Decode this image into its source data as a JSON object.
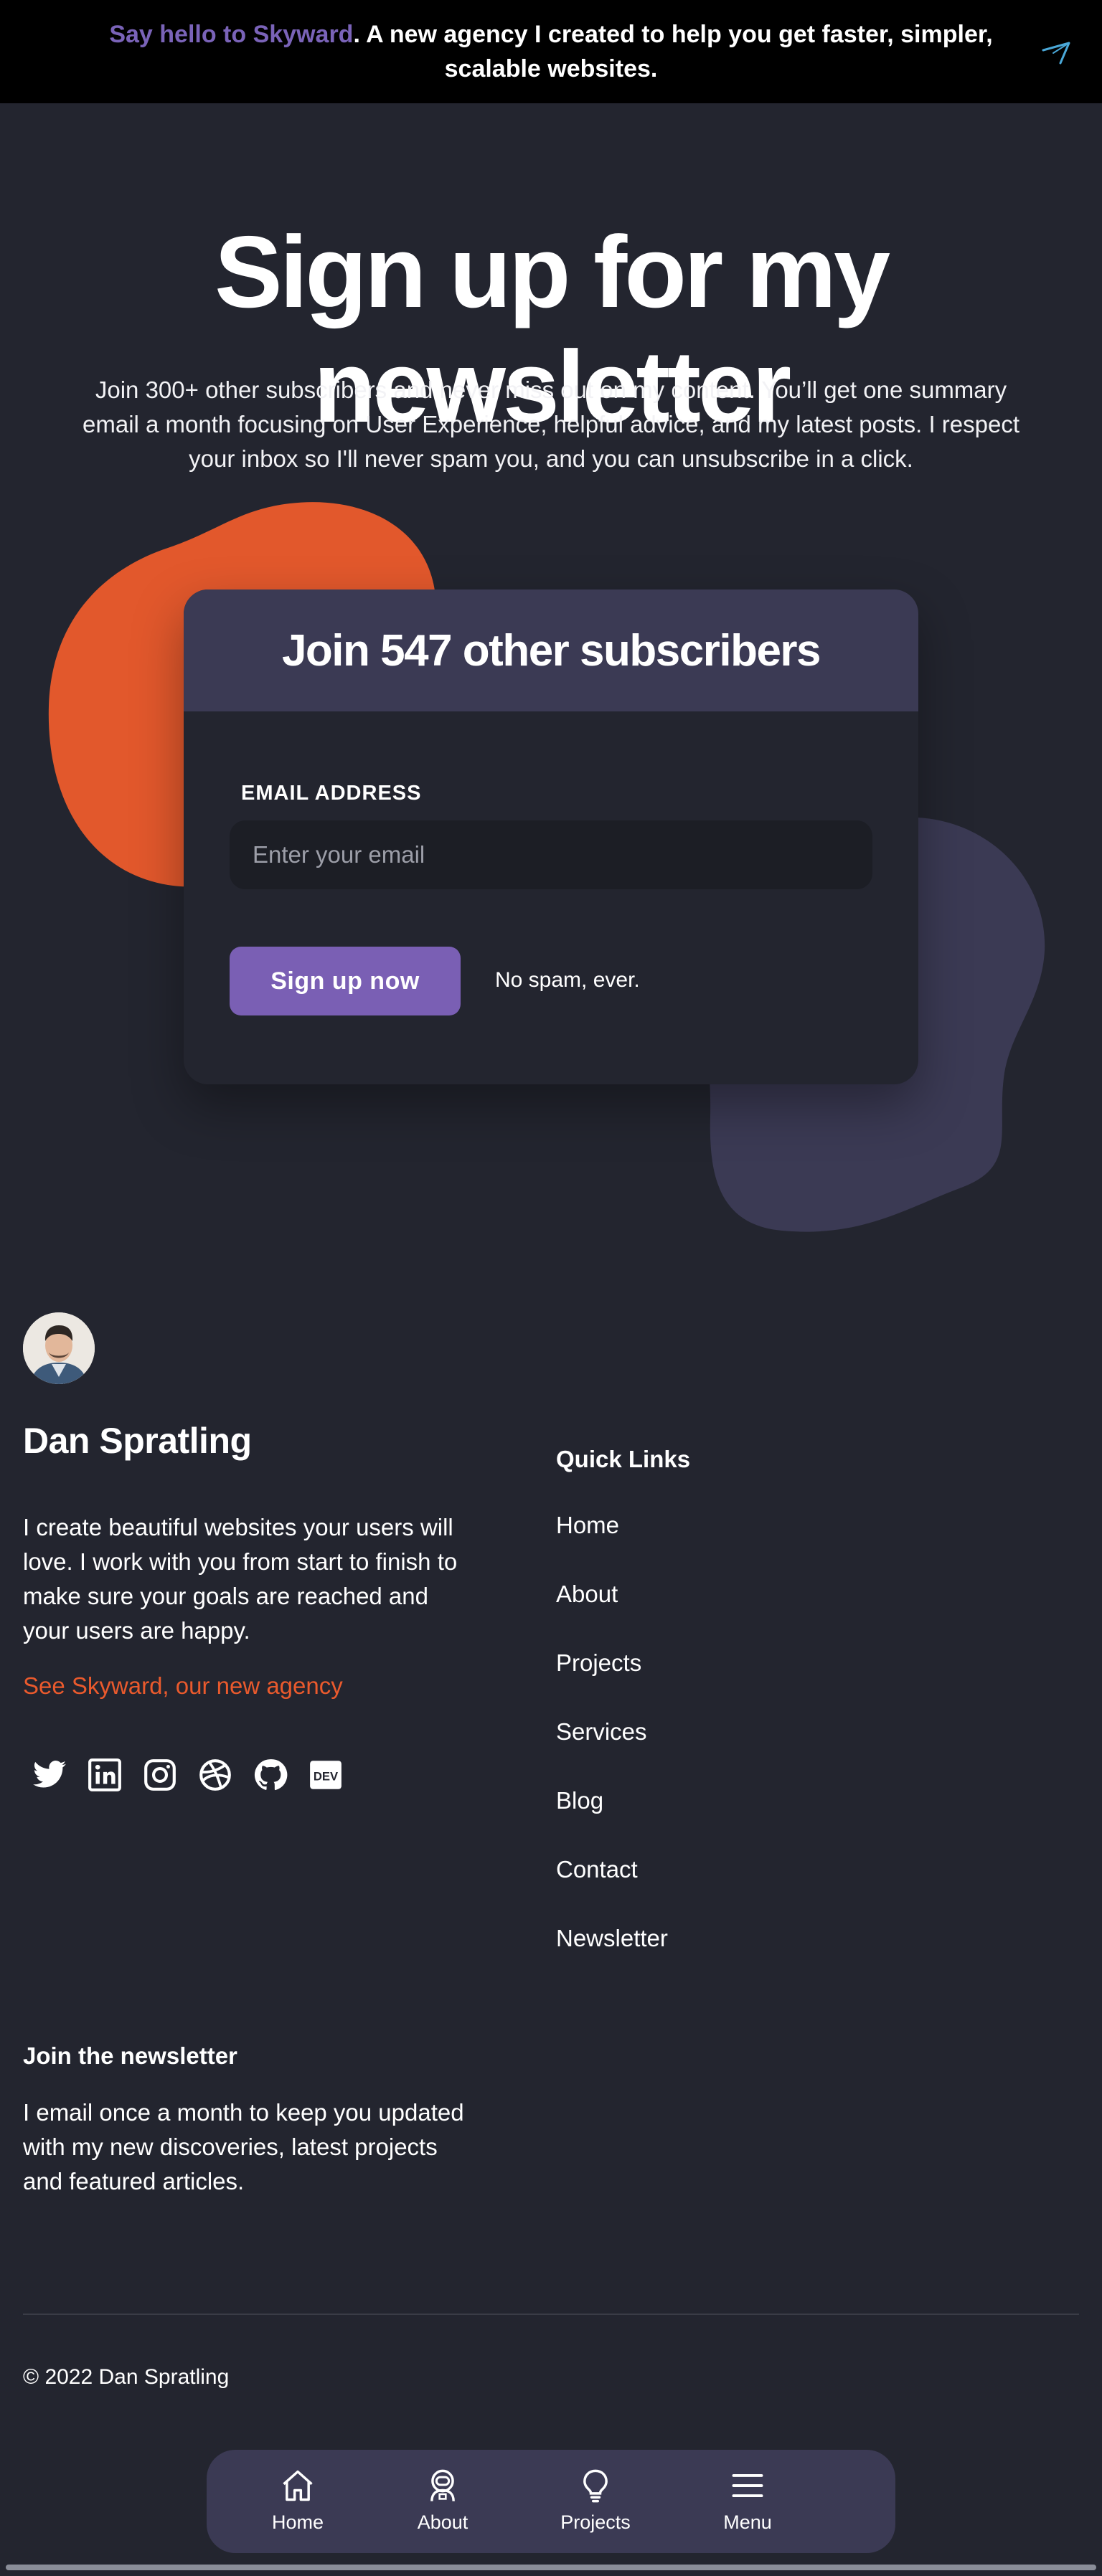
{
  "announcement": {
    "link_text": "Say hello to Skyward",
    "text": ". A new agency I created to help you get faster, simpler, scalable websites.",
    "logo_icon": "skyward-logo-icon"
  },
  "hero": {
    "title": "Sign up for my newsletter",
    "subtitle": "Join 300+ other subscribers and never miss out on my content. You’ll get one summary email a month focusing on User Experience, helpful advice, and my latest posts. I respect your inbox so I'll never spam you, and you can unsubscribe in a click."
  },
  "signup_card": {
    "title": "Join 547 other subscribers",
    "email_label": "EMAIL ADDRESS",
    "email_placeholder": "Enter your email",
    "email_value": "",
    "button_label": "Sign up now",
    "note": "No spam, ever."
  },
  "footer": {
    "author_name": "Dan Spratling",
    "bio": "I create beautiful websites your users will love. I work with you from start to finish to make sure your goals are reached and your users are happy.",
    "agency_link": "See Skyward, our new agency",
    "socials": [
      "twitter-icon",
      "linkedin-icon",
      "instagram-icon",
      "dribbble-icon",
      "github-icon",
      "dev-icon"
    ],
    "quick_links_title": "Quick Links",
    "quick_links": [
      "Home",
      "About",
      "Projects",
      "Services",
      "Blog",
      "Contact",
      "Newsletter"
    ],
    "newsletter_title": "Join the newsletter",
    "newsletter_text": "I email once a month to keep you updated with my new discoveries, latest projects and featured articles.",
    "copyright": "© 2022 Dan Spratling"
  },
  "bottom_nav": {
    "items": [
      {
        "label": "Home",
        "icon": "home-icon"
      },
      {
        "label": "About",
        "icon": "astronaut-icon"
      },
      {
        "label": "Projects",
        "icon": "lightbulb-icon"
      },
      {
        "label": "Menu",
        "icon": "menu-icon"
      }
    ]
  },
  "colors": {
    "background": "#23252f",
    "announcement_bg": "#000000",
    "accent_purple": "#7a5fb4",
    "accent_orange": "#ea5a2d",
    "card_header": "#3b3a54"
  }
}
